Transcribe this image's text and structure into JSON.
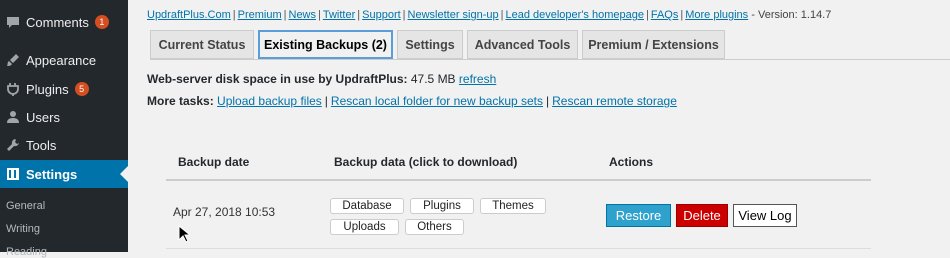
{
  "sidebar": {
    "items": [
      {
        "label": "Comments",
        "badge": "1",
        "icon": "comment-icon"
      },
      {
        "label": "Appearance",
        "icon": "paintbrush-icon"
      },
      {
        "label": "Plugins",
        "badge": "5",
        "icon": "plugin-icon"
      },
      {
        "label": "Users",
        "icon": "users-icon"
      },
      {
        "label": "Tools",
        "icon": "wrench-icon"
      },
      {
        "label": "Settings",
        "icon": "settings-icon",
        "active": true
      }
    ],
    "submenu": [
      "General",
      "Writing",
      "Reading"
    ]
  },
  "top_links": [
    "UpdraftPlus.Com",
    "Premium",
    "News",
    "Twitter",
    "Support",
    "Newsletter sign-up",
    "Lead developer's homepage",
    "FAQs",
    "More plugins"
  ],
  "version_text": "- Version: 1.14.7",
  "tabs": [
    "Current Status",
    "Existing Backups (2)",
    "Settings",
    "Advanced Tools",
    "Premium / Extensions"
  ],
  "active_tab": "Existing Backups (2)",
  "disk": {
    "label": "Web-server disk space in use by UpdraftPlus:",
    "value": "47.5 MB",
    "link": "refresh"
  },
  "more_tasks": {
    "label": "More tasks:",
    "links": [
      "Upload backup files",
      "Rescan local folder for new backup sets",
      "Rescan remote storage"
    ]
  },
  "table": {
    "headers": [
      "Backup date",
      "Backup data (click to download)",
      "Actions"
    ],
    "rows": [
      {
        "date": "Apr 27, 2018 10:53",
        "data": [
          "Database",
          "Plugins",
          "Themes",
          "Uploads",
          "Others"
        ],
        "actions": [
          "Restore",
          "Delete",
          "View Log"
        ]
      }
    ]
  },
  "colors": {
    "sidebar": "#23282d",
    "active": "#0073aa",
    "link": "#0073aa",
    "restore": "#2ea2cc",
    "delete": "#cc0000"
  }
}
